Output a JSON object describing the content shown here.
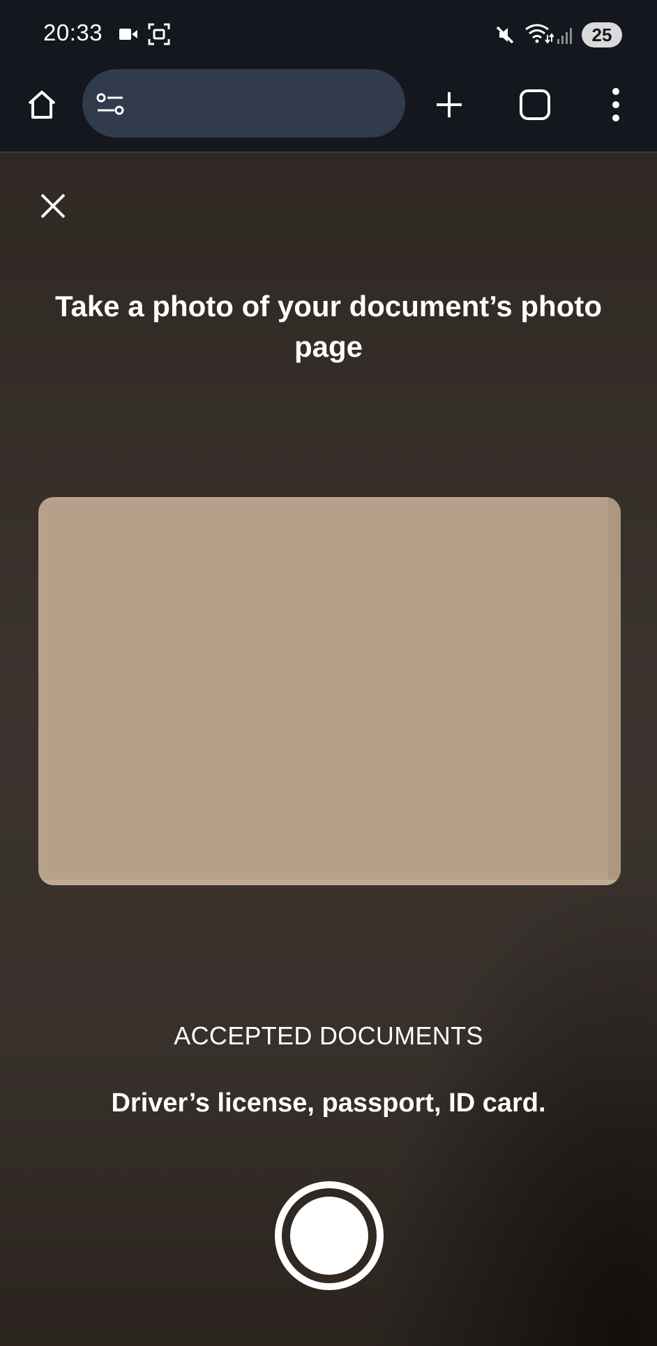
{
  "status_bar": {
    "time": "20:33",
    "battery_level": "25",
    "icons": [
      "video-camera-icon",
      "screenshot-icon",
      "mute-icon",
      "wifi-icon",
      "signal-icon"
    ]
  },
  "browser_toolbar": {
    "icons": [
      "home-icon",
      "site-settings-icon",
      "new-tab-plus-icon",
      "tab-switcher-icon",
      "more-menu-icon"
    ]
  },
  "capture": {
    "title": "Take a photo of your document’s photo page",
    "accepted_heading": "ACCEPTED DOCUMENTS",
    "accepted_list": "Driver’s license, passport, ID card.",
    "close_icon": "close-icon"
  },
  "colors": {
    "status_bg": "#14171e",
    "url_bar_bg": "#323b4b",
    "camera_bg": "#37302b",
    "document_fill": "#b8a18b",
    "text": "#ffffff"
  }
}
